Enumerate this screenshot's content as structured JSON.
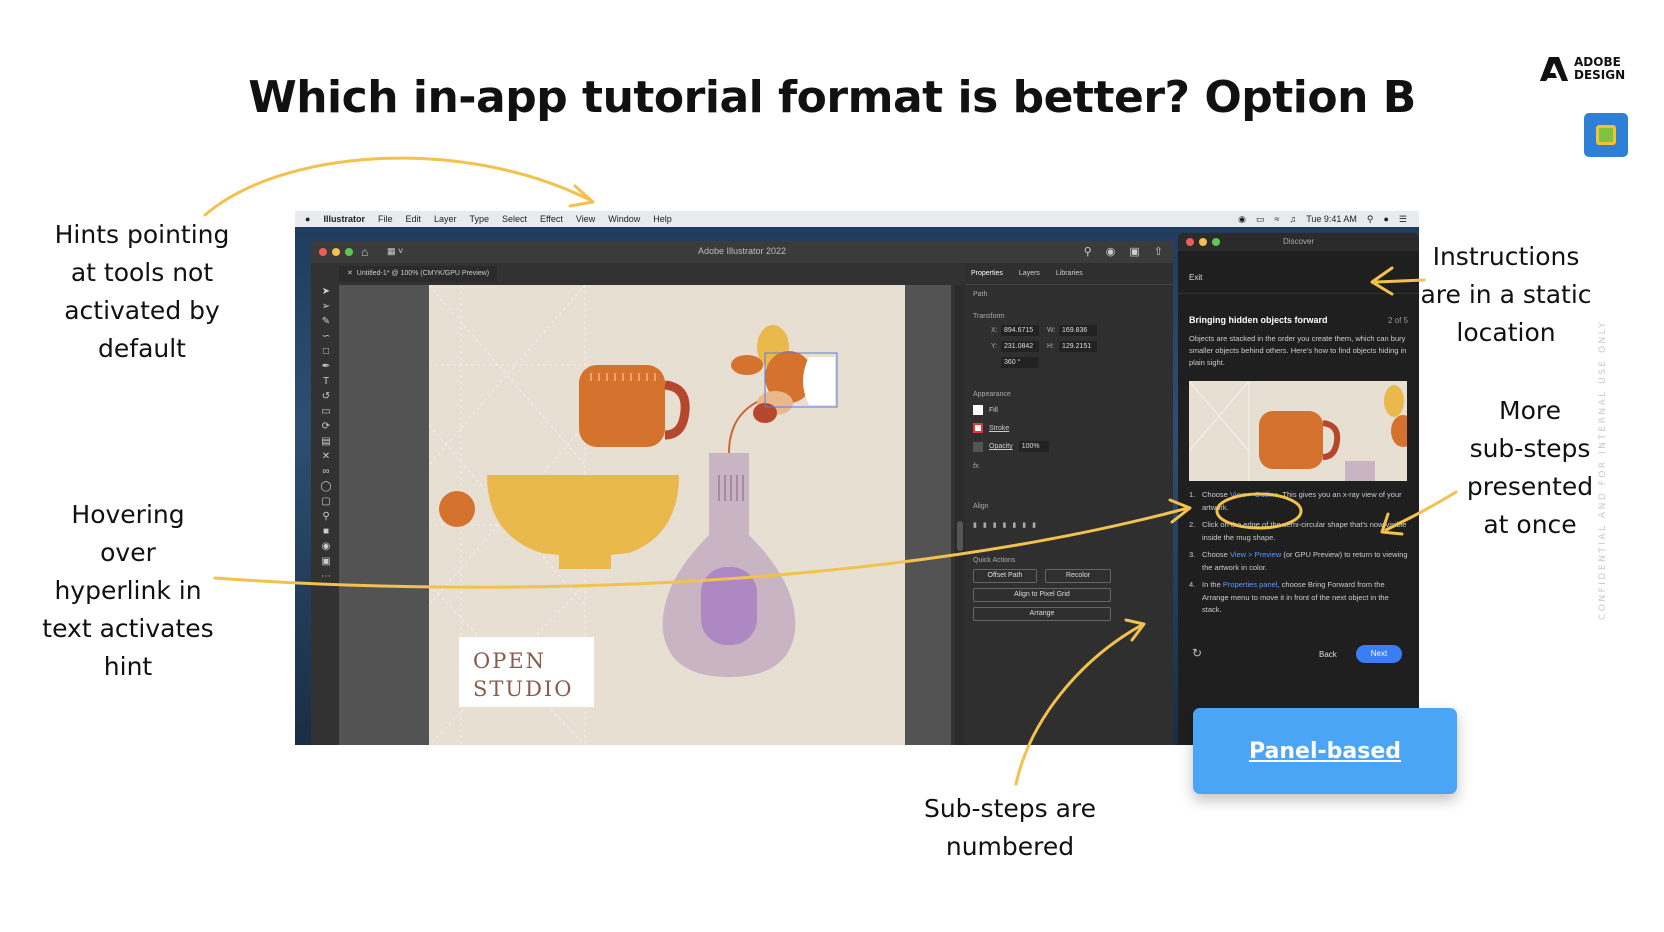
{
  "slide": {
    "title": "Which in-app tutorial format is better? Option B",
    "logo_line1": "ADOBE",
    "logo_line2": "DESIGN",
    "confidential": "CONFIDENTIAL AND FOR INTERNAL USE ONLY",
    "option_button": "Panel-based"
  },
  "callouts": {
    "hints_pointing": [
      "Hints pointing",
      "at tools not",
      "activated by",
      "default"
    ],
    "hovering": [
      "Hovering",
      "over",
      "hyperlink in",
      "text activates",
      "hint"
    ],
    "instructions": [
      "Instructions",
      "are in a static",
      "location"
    ],
    "more_substeps": [
      "More",
      "sub-steps",
      "presented",
      "at once"
    ],
    "substeps_numbered": [
      "Sub-steps are",
      "numbered"
    ]
  },
  "mac_menubar": {
    "app": "Illustrator",
    "items": [
      "File",
      "Edit",
      "Layer",
      "Type",
      "Select",
      "Effect",
      "View",
      "Window",
      "Help"
    ],
    "clock": "Tue 9:41 AM"
  },
  "illustrator": {
    "window_title": "Adobe Illustrator 2022",
    "doc_tab": "Untitled-1* @ 100% (CMYK/GPU Preview)",
    "artwork_text_line1": "OPEN",
    "artwork_text_line2": "STUDIO",
    "properties": {
      "tabs": [
        "Properties",
        "Layers",
        "Libraries"
      ],
      "path": "Path",
      "transform": "Transform",
      "x_label": "X:",
      "x_value": "894.6715",
      "y_label": "Y:",
      "y_value": "231.0842",
      "w_label": "W:",
      "w_value": "169.836",
      "h_label": "H:",
      "h_value": "129.2151",
      "angle": "360 °",
      "appearance": "Appearance",
      "fill": "Fill",
      "stroke": "Stroke",
      "opacity": "Opacity",
      "opacity_value": "100%",
      "fx": "fx.",
      "align": "Align",
      "quick_actions": "Quick Actions",
      "offset_path": "Offset Path",
      "recolor": "Recolor",
      "align_pixel_grid": "Align to Pixel Grid",
      "arrange": "Arrange"
    }
  },
  "discover": {
    "title": "Discover",
    "exit": "Exit",
    "heading": "Bringing hidden objects forward",
    "counter": "2 of 5",
    "intro": "Objects are stacked in the order you create them, which can bury smaller objects behind others. Here's how to find objects hiding in plain sight.",
    "steps": [
      {
        "num": "1.",
        "pre": "Choose ",
        "link": "View > Outline",
        "post": ". This gives you an x-ray view of your artwork."
      },
      {
        "num": "2.",
        "pre": "Click on the edge of the semi-circular shape that's now visible inside the mug shape.",
        "link": "",
        "post": ""
      },
      {
        "num": "3.",
        "pre": "Choose ",
        "link": "View > Preview",
        "post": " (or GPU Preview) to return to viewing the artwork in color."
      },
      {
        "num": "4.",
        "pre": "In the ",
        "link": "Properties panel",
        "post": ", choose Bring Forward from the Arrange menu to move it in front of the next object in the stack."
      }
    ],
    "back": "Back",
    "next": "Next"
  },
  "colors": {
    "annotation_stroke": "#f2c14e",
    "button_blue": "#4aa5f6",
    "link_blue": "#5a9bff",
    "next_blue": "#3b7df2"
  },
  "icons": [
    "apple-icon",
    "home-icon",
    "search-icon",
    "close-icon",
    "refresh-icon",
    "chevron-down-icon",
    "wifi-icon",
    "battery-icon"
  ]
}
